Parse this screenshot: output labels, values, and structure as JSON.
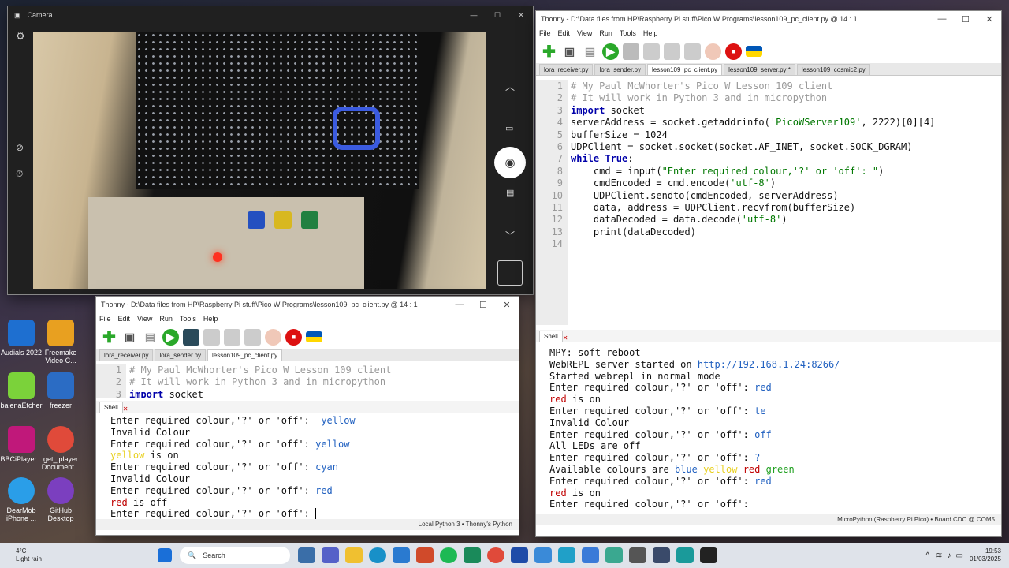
{
  "camera": {
    "title": "Camera"
  },
  "desktop": {
    "icons": [
      {
        "label": "Audials 2022"
      },
      {
        "label": "Freemake Video C..."
      },
      {
        "label": "balenaEtcher"
      },
      {
        "label": "freezer"
      },
      {
        "label": "BBCiPlayer..."
      },
      {
        "label": "get_iplayer Document..."
      },
      {
        "label": "DearMob iPhone ..."
      },
      {
        "label": "GitHub Desktop"
      }
    ]
  },
  "thonny_main": {
    "title": "Thonny  -  D:\\Data files from HP\\Raspberry Pi stuff\\Pico W Programs\\lesson109_pc_client.py  @  14 : 1",
    "menu": [
      "File",
      "Edit",
      "View",
      "Run",
      "Tools",
      "Help"
    ],
    "tabs": [
      "lora_receiver.py",
      "lora_sender.py",
      "lesson109_pc_client.py",
      "lesson109_server.py *",
      "lesson109_cosmic2.py"
    ],
    "line_numbers": [
      "1",
      "2",
      "3",
      "4",
      "5",
      "6",
      "7",
      "8",
      "9",
      "10",
      "11",
      "12",
      "13",
      "14"
    ],
    "shell_label": "Shell",
    "shell_lines": [
      "MPY: soft reboot",
      "WebREPL server started on http://192.168.1.24:8266/",
      "Started webrepl in normal mode",
      "Enter required colour,'?' or 'off': red",
      "red is on",
      "Enter required colour,'?' or 'off': te",
      "Invalid Colour",
      "Enter required colour,'?' or 'off': off",
      "All LEDs are off",
      "Enter required colour,'?' or 'off': ?",
      "Available colours are blue yellow red green",
      "Enter required colour,'?' or 'off': red",
      "red is on",
      "Enter required colour,'?' or 'off':"
    ],
    "status": "MicroPython (Raspberry Pi Pico)  •  Board CDC @ COM5"
  },
  "thonny_second": {
    "title": "Thonny  -  D:\\Data files from HP\\Raspberry Pi stuff\\Pico W Programs\\lesson109_pc_client.py  @  14 : 1",
    "menu": [
      "File",
      "Edit",
      "View",
      "Run",
      "Tools",
      "Help"
    ],
    "tabs": [
      "lora_receiver.py",
      "lora_sender.py",
      "lesson109_pc_client.py"
    ],
    "line_numbers": [
      "1",
      "2",
      "3"
    ],
    "shell_label": "Shell",
    "shell_lines": [
      "Enter required colour,'?' or 'off':  yellow",
      "Invalid Colour",
      "Enter required colour,'?' or 'off': yellow",
      "yellow is on",
      "Enter required colour,'?' or 'off': cyan",
      "Invalid Colour",
      "Enter required colour,'?' or 'off': red",
      "red is off",
      "Enter required colour,'?' or 'off': "
    ],
    "status": "Local Python 3  •  Thonny's Python"
  },
  "taskbar": {
    "weather_temp": "4°C",
    "weather_desc": "Light rain",
    "search": "Search",
    "time": "19:53",
    "date": "01/03/2025"
  }
}
